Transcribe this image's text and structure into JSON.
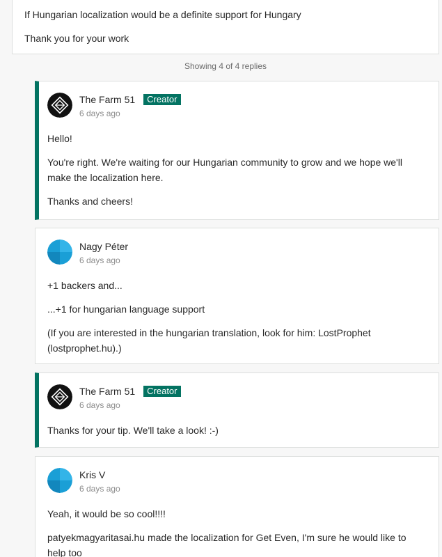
{
  "top_comment": {
    "lines": [
      "If Hungarian localization would be a definite support for Hungary",
      "Thank you for your work"
    ]
  },
  "replies_count": "Showing 4 of 4 replies",
  "replies": [
    {
      "author": "The Farm 51",
      "badge": "Creator",
      "time": "6 days ago",
      "paragraphs": [
        "Hello!",
        "You're right. We're waiting for our Hungarian community to grow and we hope we'll make the localization here.",
        "Thanks and cheers!"
      ]
    },
    {
      "author": "Nagy Péter",
      "time": "6 days ago",
      "paragraphs": [
        "+1 backers and...",
        "...+1 for hungarian language support",
        "(If you are interested in the hungarian translation, look for him: LostProphet (lostprophet.hu).)"
      ]
    },
    {
      "author": "The Farm 51",
      "badge": "Creator",
      "time": "6 days ago",
      "paragraphs": [
        "Thanks for your tip. We'll take a look! :-)"
      ]
    },
    {
      "author": "Kris V",
      "time": "6 days ago",
      "paragraphs": [
        "Yeah, it would be so cool!!!!",
        "patyekmagyaritasai.hu made the localization for Get Even, I'm sure he would like to help too"
      ]
    }
  ],
  "colors": {
    "creator_accent": "#037362",
    "default_avatar": "#1a9fd6"
  }
}
